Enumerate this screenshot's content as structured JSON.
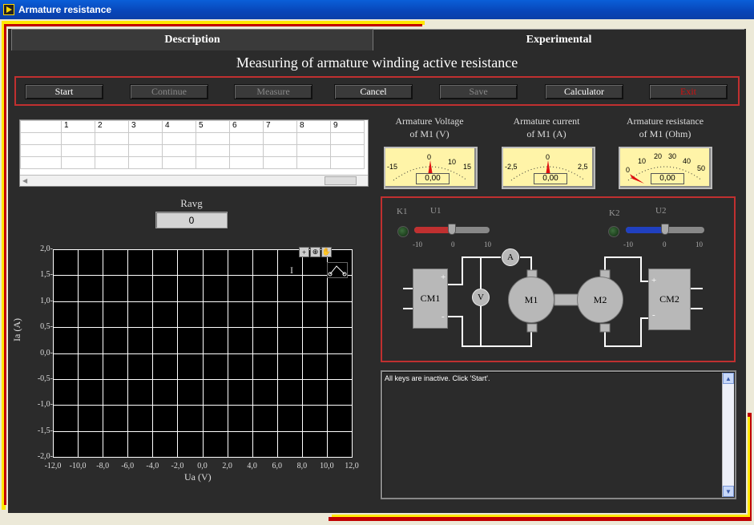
{
  "window": {
    "title": "Armature resistance"
  },
  "tabs": [
    {
      "label": "Description"
    },
    {
      "label": "Experimental"
    }
  ],
  "heading": "Measuring of armature winding active resistance",
  "buttons": {
    "start": "Start",
    "continue": "Continue",
    "measure": "Measure",
    "cancel": "Cancel",
    "save": "Save",
    "calculator": "Calculator",
    "exit": "Exit"
  },
  "table": {
    "columns": [
      "1",
      "2",
      "3",
      "4",
      "5",
      "6",
      "7",
      "8",
      "9"
    ],
    "rows": 3
  },
  "ravg": {
    "label": "Ravg",
    "value": "0"
  },
  "graph": {
    "ylabel": "Ia (A)",
    "xlabel": "Ua (V)",
    "yticks": [
      "2,0",
      "1,5",
      "1,0",
      "0,5",
      "0,0",
      "-0,5",
      "-1,0",
      "-1,5",
      "-2,0"
    ],
    "xticks": [
      "-12,0",
      "-10,0",
      "-8,0",
      "-6,0",
      "-4,0",
      "-2,0",
      "0,0",
      "2,0",
      "4,0",
      "6,0",
      "8,0",
      "10,0",
      "12,0"
    ],
    "cursor_label": "I"
  },
  "meters": [
    {
      "label_line1": "Armature Voltage",
      "label_line2": "of M1 (V)",
      "value": "0,00",
      "scale": [
        "-15",
        "0",
        "10",
        "15"
      ],
      "needle_fraction": 0.5
    },
    {
      "label_line1": "Armature current",
      "label_line2": "of  M1 (A)",
      "value": "0,00",
      "scale": [
        "-2,5",
        "0",
        "2,5"
      ],
      "needle_fraction": 0.5
    },
    {
      "label_line1": "Armature resistance",
      "label_line2": "of M1 (Ohm)",
      "value": "0,00",
      "scale": [
        "0",
        "10",
        "20",
        "30",
        "40",
        "50"
      ],
      "needle_fraction": 0.0
    }
  ],
  "circuit": {
    "k1": "K1",
    "u1": "U1",
    "k2": "K2",
    "u2": "U2",
    "slider_scale": [
      "-10",
      "0",
      "10"
    ],
    "u1_value": 0,
    "u2_value": 0,
    "cm1": "CM1",
    "cm2": "CM2",
    "m1": "M1",
    "m2": "M2",
    "ammeter": "A",
    "voltmeter": "V",
    "plus": "+",
    "minus": "-",
    "colors": {
      "u1_fill": "#c03030",
      "u2_fill": "#2040c0"
    }
  },
  "message": "All keys are inactive. Click 'Start'."
}
